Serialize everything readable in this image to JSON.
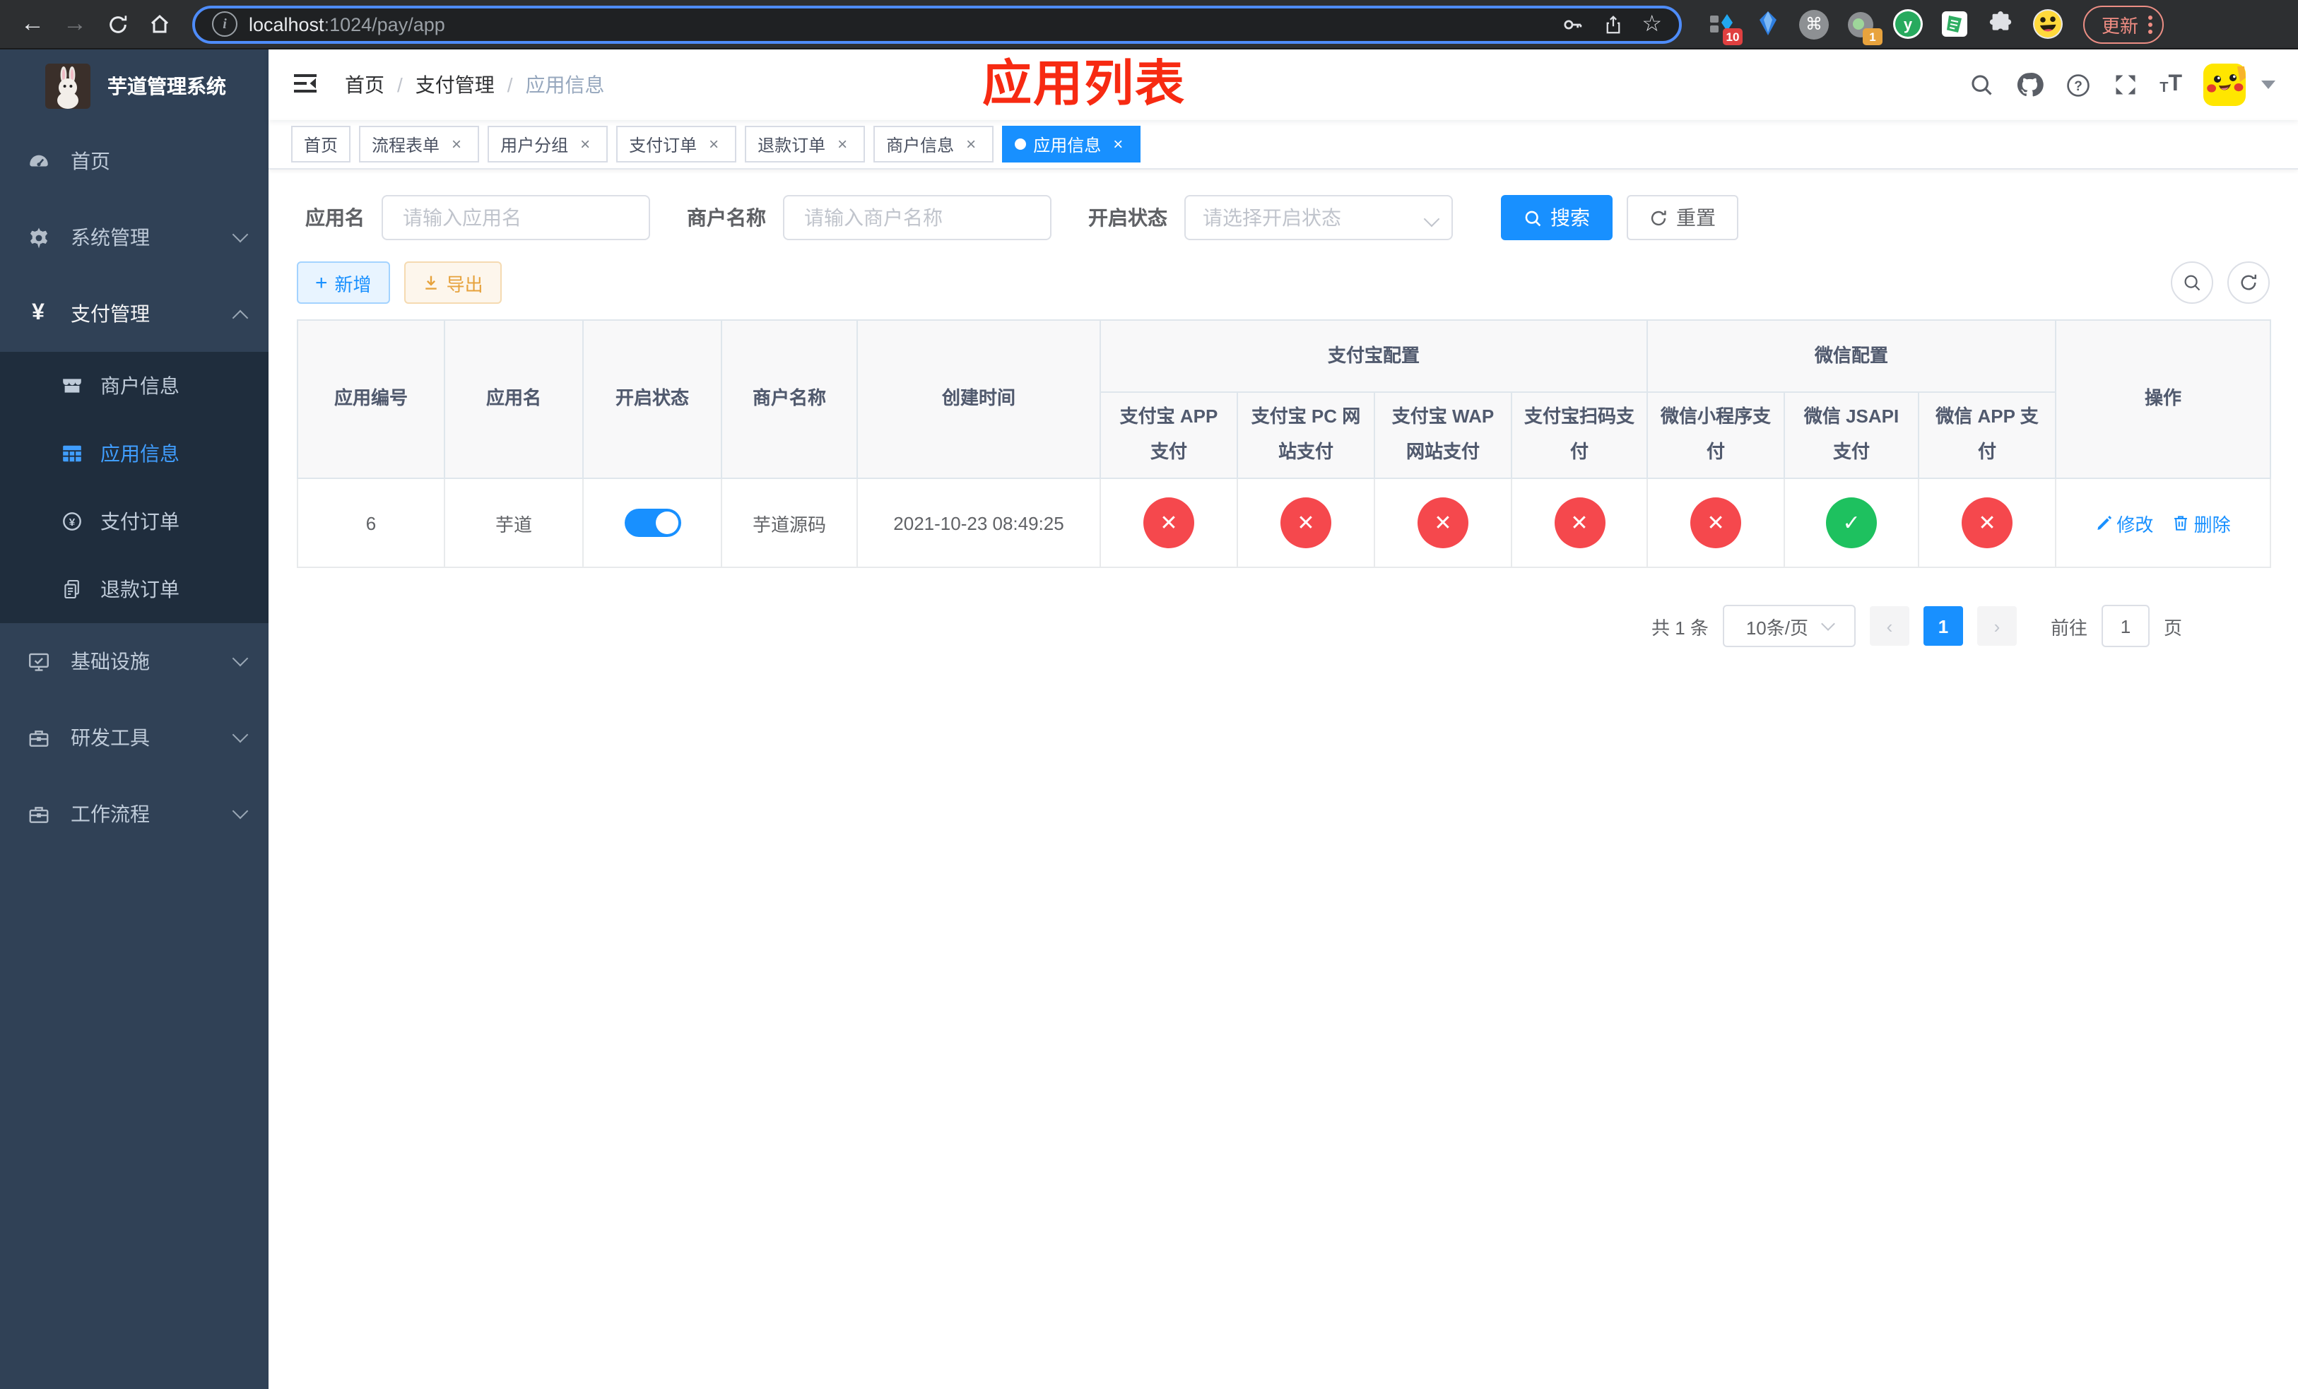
{
  "browser": {
    "url": {
      "host": "localhost",
      "path": ":1024/pay/app"
    },
    "update_label": "更新",
    "extension_badges": {
      "first": "10",
      "second": "1"
    },
    "ext_letter": "y"
  },
  "sidebar": {
    "title": "芋道管理系统",
    "menu": [
      {
        "label": "首页"
      },
      {
        "label": "系统管理"
      },
      {
        "label": "支付管理"
      },
      {
        "label": "商户信息"
      },
      {
        "label": "应用信息"
      },
      {
        "label": "支付订单"
      },
      {
        "label": "退款订单"
      },
      {
        "label": "基础设施"
      },
      {
        "label": "研发工具"
      },
      {
        "label": "工作流程"
      }
    ]
  },
  "navbar": {
    "breadcrumb": {
      "level1": "首页",
      "level2": "支付管理",
      "level3": "应用信息"
    },
    "annotation": "应用列表"
  },
  "tabs": [
    {
      "label": "首页"
    },
    {
      "label": "流程表单"
    },
    {
      "label": "用户分组"
    },
    {
      "label": "支付订单"
    },
    {
      "label": "退款订单"
    },
    {
      "label": "商户信息"
    },
    {
      "label": "应用信息"
    }
  ],
  "filters": {
    "app_name": {
      "label": "应用名",
      "placeholder": "请输入应用名"
    },
    "merchant_name": {
      "label": "商户名称",
      "placeholder": "请输入商户名称"
    },
    "status": {
      "label": "开启状态",
      "placeholder": "请选择开启状态"
    },
    "search_label": "搜索",
    "reset_label": "重置"
  },
  "actions": {
    "add": "新增",
    "export": "导出"
  },
  "table": {
    "headers": {
      "app_id": "应用编号",
      "app_name": "应用名",
      "status": "开启状态",
      "merchant": "商户名称",
      "create_time": "创建时间",
      "alipay_group": "支付宝配置",
      "wechat_group": "微信配置",
      "alipay_app": "支付宝 APP 支付",
      "alipay_pc": "支付宝 PC 网站支付",
      "alipay_wap": "支付宝 WAP 网站支付",
      "alipay_qr": "支付宝扫码支付",
      "wx_mini": "微信小程序支付",
      "wx_jsapi": "微信 JSAPI 支付",
      "wx_app": "微信 APP 支付",
      "ops": "操作"
    },
    "row": {
      "app_id": "6",
      "app_name": "芋道",
      "enabled": true,
      "merchant": "芋道源码",
      "create_time": "2021-10-23 08:49:25",
      "statuses": [
        "no",
        "no",
        "no",
        "no",
        "no",
        "yes",
        "no"
      ],
      "edit": "修改",
      "delete": "删除"
    }
  },
  "pagination": {
    "total": "共 1 条",
    "size": "10条/页",
    "page": "1",
    "goto": "前往",
    "goto_value": "1",
    "unit": "页"
  }
}
